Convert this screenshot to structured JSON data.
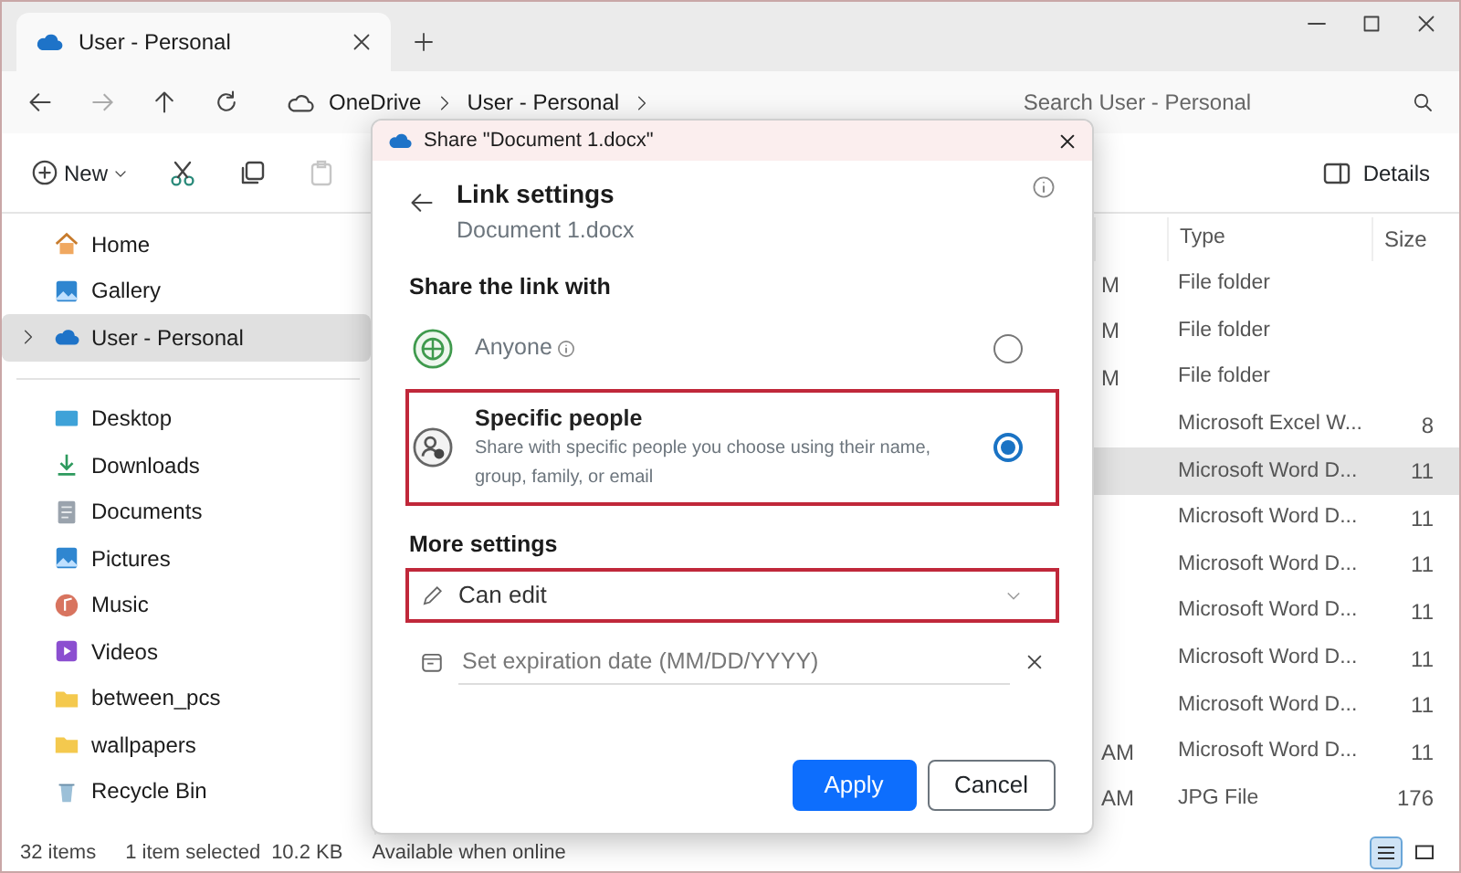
{
  "window": {
    "tab_title": "User - Personal"
  },
  "nav": {
    "breadcrumb": [
      "OneDrive",
      "User - Personal"
    ],
    "search": {
      "placeholder": "Search User - Personal"
    }
  },
  "commands": [
    {
      "kind": "new",
      "label": "New"
    },
    {
      "kind": "cut"
    },
    {
      "kind": "copy"
    },
    {
      "kind": "paste",
      "disabled": true
    }
  ],
  "details_button": {
    "label": "Details"
  },
  "sidebar": {
    "groups": [
      [
        {
          "kind": "home",
          "label": "Home",
          "selected": false
        },
        {
          "kind": "gallery",
          "label": "Gallery",
          "selected": false
        },
        {
          "kind": "cloud",
          "label": "User - Personal",
          "selected": true,
          "expanded": false
        }
      ],
      [
        {
          "kind": "desktop",
          "label": "Desktop",
          "selected": false
        },
        {
          "kind": "downloads",
          "label": "Downloads",
          "selected": false
        },
        {
          "kind": "documents",
          "label": "Documents",
          "selected": false
        },
        {
          "kind": "pictures",
          "label": "Pictures",
          "selected": false
        },
        {
          "kind": "music",
          "label": "Music",
          "selected": false
        },
        {
          "kind": "videos",
          "label": "Videos",
          "selected": false
        },
        {
          "kind": "folder",
          "label": "between_pcs",
          "selected": false
        },
        {
          "kind": "folder",
          "label": "wallpapers",
          "selected": false
        },
        {
          "kind": "recycle",
          "label": "Recycle Bin",
          "selected": false
        }
      ]
    ]
  },
  "table": {
    "columns": [
      "Type",
      "Size"
    ],
    "rows": [
      {
        "column_1": "M",
        "type": "File folder",
        "selected": false
      },
      {
        "column_1": "M",
        "type": "File folder",
        "selected": false
      },
      {
        "column_1": "M",
        "type": "File folder",
        "selected": false
      },
      {
        "type": "Microsoft Excel W...",
        "size": "8",
        "selected": false
      },
      {
        "type": "Microsoft Word D...",
        "size": "11",
        "selected": true
      },
      {
        "type": "Microsoft Word D...",
        "size": "11",
        "selected": false
      },
      {
        "type": "Microsoft Word D...",
        "size": "11",
        "selected": false
      },
      {
        "type": "Microsoft Word D...",
        "size": "11",
        "selected": false
      },
      {
        "type": "Microsoft Word D...",
        "size": "11",
        "selected": false
      },
      {
        "type": "Microsoft Word D...",
        "size": "11",
        "selected": false
      },
      {
        "column_1": "AM",
        "type": "Microsoft Word D...",
        "size": "11",
        "selected": false
      },
      {
        "column_1": "AM",
        "type": "JPG File",
        "size": "176",
        "selected": false
      }
    ]
  },
  "status_bar": {
    "count": "32 items",
    "selection": "1 item selected",
    "size": "10.2 KB",
    "availability": "Available when online",
    "views": [
      {
        "kind": "details",
        "selected": true
      },
      {
        "kind": "tiles",
        "selected": false
      }
    ]
  },
  "dialog": {
    "title": "Share \"Document 1.docx\"",
    "heading": "Link settings",
    "subtitle": "Document 1.docx",
    "section": "Share the link with",
    "options": [
      {
        "kind": "globe",
        "label": "Anyone",
        "info": true,
        "selected": false,
        "highlighted": false
      },
      {
        "kind": "people",
        "label": "Specific people",
        "description": "Share with specific people you choose using their name, group, family, or email",
        "selected": true,
        "highlighted": true
      }
    ],
    "more_settings": "More settings",
    "permission": {
      "label": "Can edit",
      "highlighted": true
    },
    "expiration": {
      "placeholder": "Set expiration date (MM/DD/YYYY)"
    },
    "buttons": [
      {
        "kind": "primary",
        "label": "Apply"
      },
      {
        "kind": "secondary",
        "label": "Cancel"
      }
    ]
  }
}
